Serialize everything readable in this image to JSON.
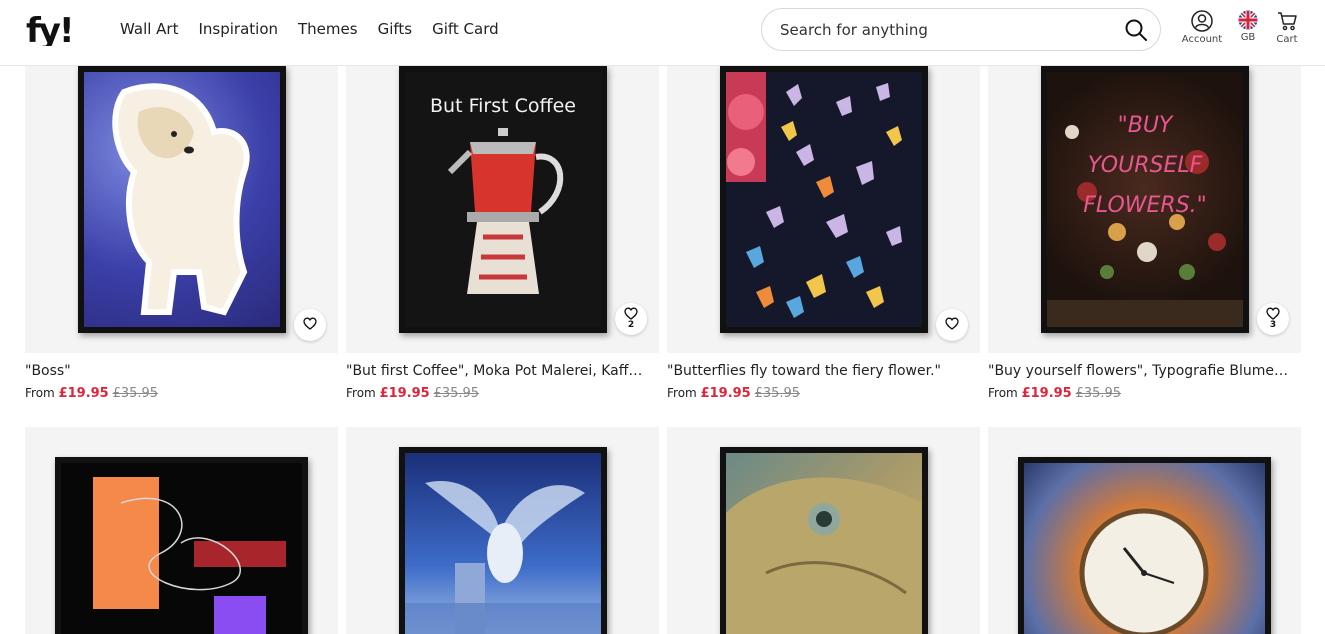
{
  "header": {
    "logo_text": "fy!",
    "nav": [
      "Wall Art",
      "Inspiration",
      "Themes",
      "Gifts",
      "Gift Card"
    ],
    "search_placeholder": "Search for anything",
    "account_label": "Account",
    "region_label": "GB",
    "cart_label": "Cart"
  },
  "colors": {
    "price_red": "#e0243a",
    "card_bg": "#f4f4f4",
    "frame": "#111111"
  },
  "products": [
    {
      "title": "\"Boss\"",
      "from_label": "From",
      "price": "£19.95",
      "was": "£35.95",
      "fav_count": ""
    },
    {
      "title": "\"But first Coffee\", Moka Pot Malerei, Kaffee…",
      "from_label": "From",
      "price": "£19.95",
      "was": "£35.95",
      "fav_count": "2"
    },
    {
      "title": "\"Butterflies fly toward the fiery flower.\"",
      "from_label": "From",
      "price": "£19.95",
      "was": "£35.95",
      "fav_count": ""
    },
    {
      "title": "\"Buy yourself flowers\", Typografie Blumen…",
      "from_label": "From",
      "price": "£19.95",
      "was": "£35.95",
      "fav_count": "3"
    },
    {
      "title": "",
      "from_label": "",
      "price": "",
      "was": "",
      "fav_count": ""
    },
    {
      "title": "",
      "from_label": "",
      "price": "",
      "was": "",
      "fav_count": ""
    },
    {
      "title": "",
      "from_label": "",
      "price": "",
      "was": "",
      "fav_count": ""
    },
    {
      "title": "",
      "from_label": "",
      "price": "",
      "was": "",
      "fav_count": ""
    }
  ],
  "artwork_text": {
    "coffee_headline": "But First Coffee",
    "flowers_headline": "\"BUY YOURSELF FLOWERS.\""
  }
}
